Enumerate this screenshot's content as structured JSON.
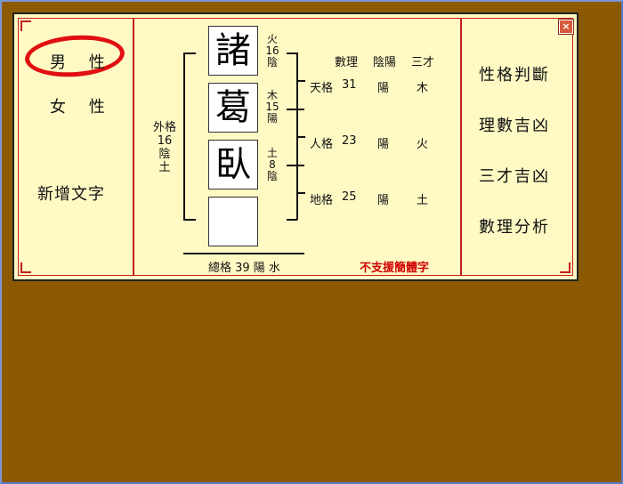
{
  "left_menu": {
    "male": "男 性",
    "female": "女 性",
    "add_char": "新增文字"
  },
  "name_chars": [
    "諸",
    "葛",
    "臥",
    ""
  ],
  "char_info": [
    {
      "element": "火",
      "strokes": "16",
      "yinyang": "陰"
    },
    {
      "element": "木",
      "strokes": "15",
      "yinyang": "陽"
    },
    {
      "element": "土",
      "strokes": "8",
      "yinyang": "陰"
    }
  ],
  "waige": {
    "label": "外格",
    "number": "16",
    "yinyang": "陰",
    "element": "土"
  },
  "table": {
    "headers": [
      "數理",
      "陰陽",
      "三才"
    ],
    "rows": [
      {
        "label": "天格",
        "number": "31",
        "yinyang": "陽",
        "element": "木"
      },
      {
        "label": "人格",
        "number": "23",
        "yinyang": "陽",
        "element": "火"
      },
      {
        "label": "地格",
        "number": "25",
        "yinyang": "陽",
        "element": "土"
      }
    ]
  },
  "zongge": "總格 39 陽 水",
  "warning": "不支援簡體字",
  "right_menu": [
    "性格判斷",
    "理數吉凶",
    "三才吉凶",
    "數理分析"
  ],
  "close_label": "×",
  "colors": {
    "background": "#8B5A00",
    "panel": "#FFF9C4",
    "accent": "#C41E1E",
    "highlight": "#E01010"
  }
}
